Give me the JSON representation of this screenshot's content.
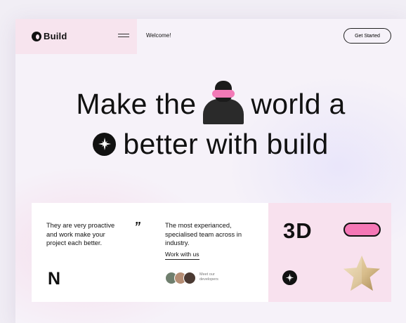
{
  "header": {
    "logo_text": "Build",
    "welcome": "Welcome!",
    "cta_label": "Get Started"
  },
  "hero": {
    "line1_a": "Make the",
    "line1_b": "world a",
    "line2": "better with build"
  },
  "cards": {
    "left_text": "They are very proactive and work make your project each better.",
    "quote_mark": "”",
    "n_mark": "N",
    "right_text": "The most experianced, specialised team across in industry.",
    "link_label": "Work with us",
    "developers_label": "Meet our developers"
  },
  "feature": {
    "label_3d": "3D"
  },
  "icons": [
    "logo-icon",
    "menu-icon",
    "sparkle-icon",
    "star-icon",
    "pill-shape"
  ],
  "colors": {
    "accent_pink": "#f577b6",
    "panel_pink": "#f8e1ee",
    "header_pink": "#f7e4ee",
    "page_bg": "#f6f2f9"
  }
}
